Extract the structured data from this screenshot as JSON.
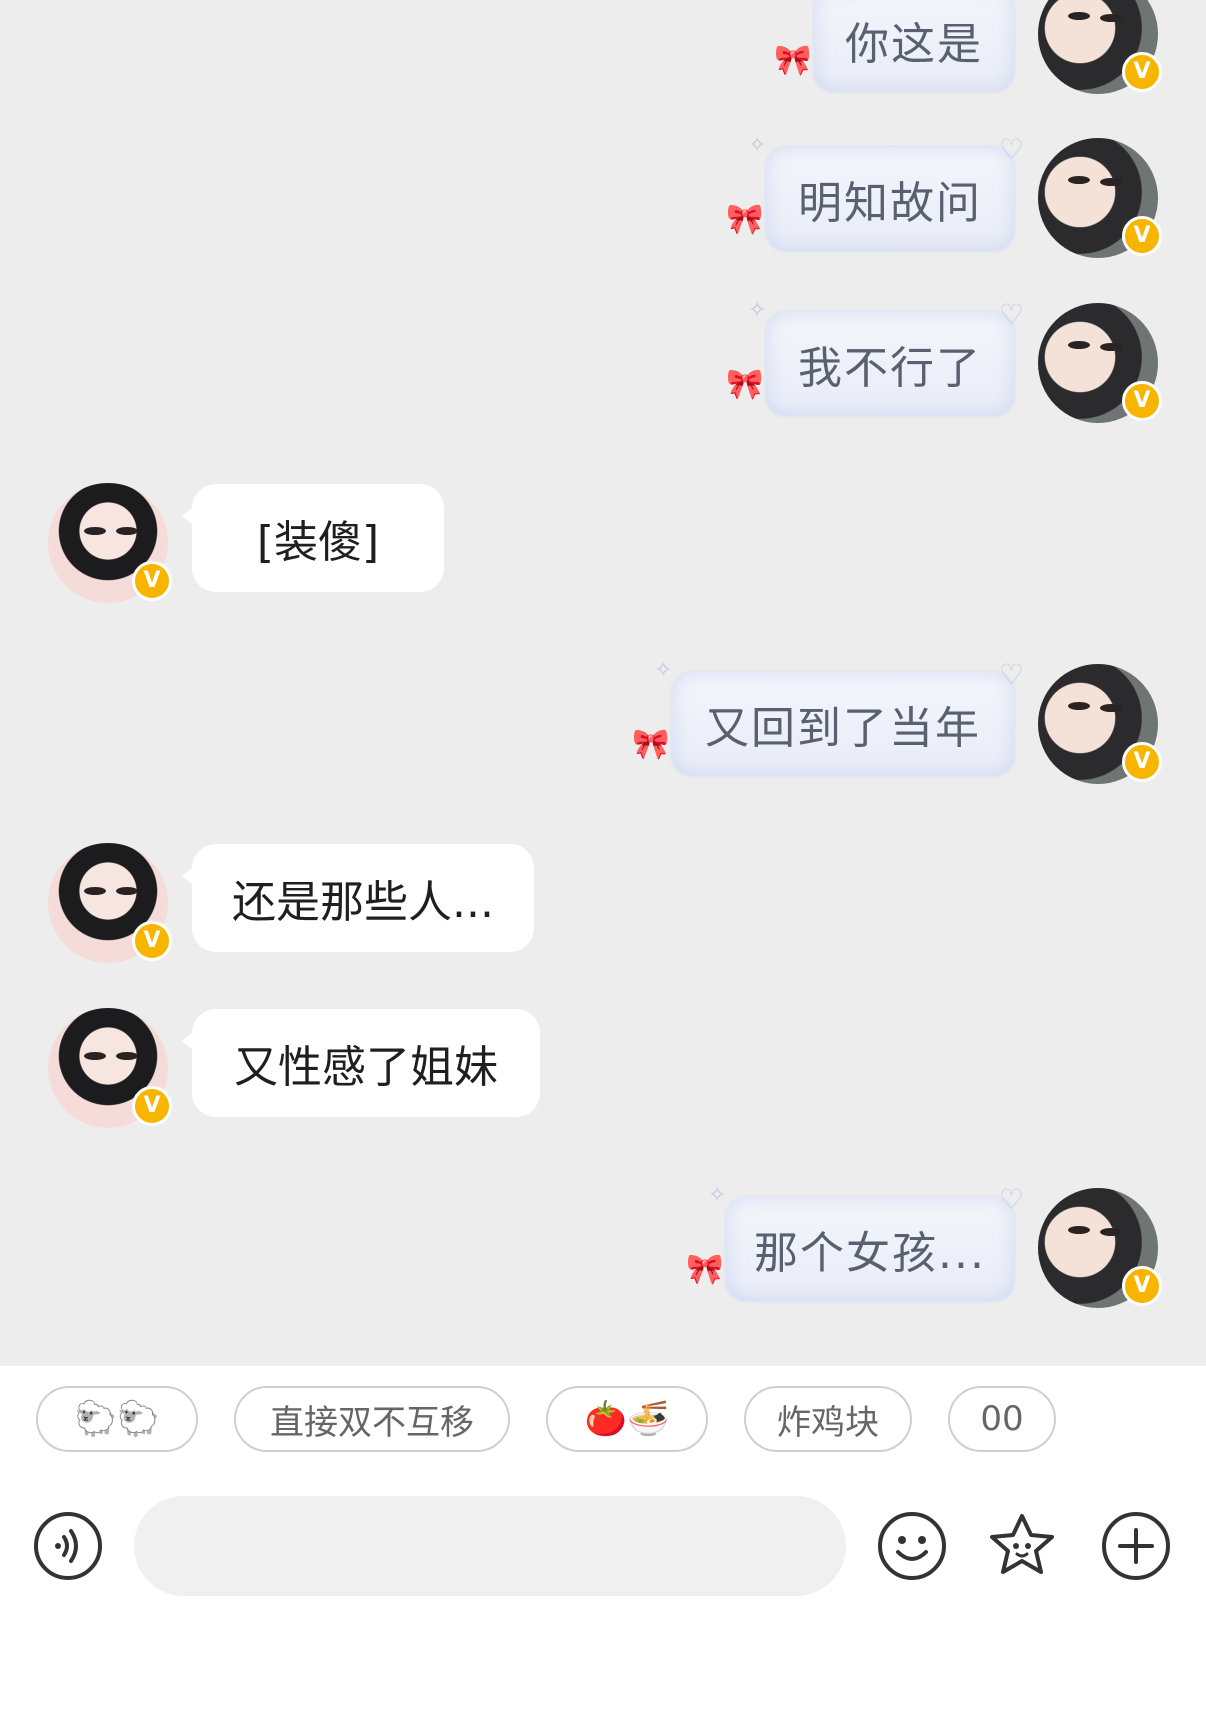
{
  "messages": [
    {
      "side": "me",
      "text": "你这是"
    },
    {
      "side": "me",
      "text": "明知故问"
    },
    {
      "side": "me",
      "text": "我不行了"
    },
    {
      "side": "her",
      "text": "[装傻]"
    },
    {
      "side": "me",
      "text": "又回到了当年"
    },
    {
      "side": "her",
      "text": "还是那些人..."
    },
    {
      "side": "her",
      "text": "又性感了姐妹"
    },
    {
      "side": "me",
      "text": "那个女孩..."
    }
  ],
  "badge_label": "V",
  "quick_replies": [
    "🐑🐑",
    "直接双不互移",
    "🍅🍜",
    "炸鸡块",
    "00"
  ],
  "input": {
    "placeholder": ""
  },
  "icons": [
    "voice-icon",
    "emoji-icon",
    "sticker-star-icon",
    "plus-icon"
  ],
  "colors": {
    "badge": "#f7b500",
    "chat_bg": "#ededed",
    "bubble_me_text": "#596070"
  }
}
